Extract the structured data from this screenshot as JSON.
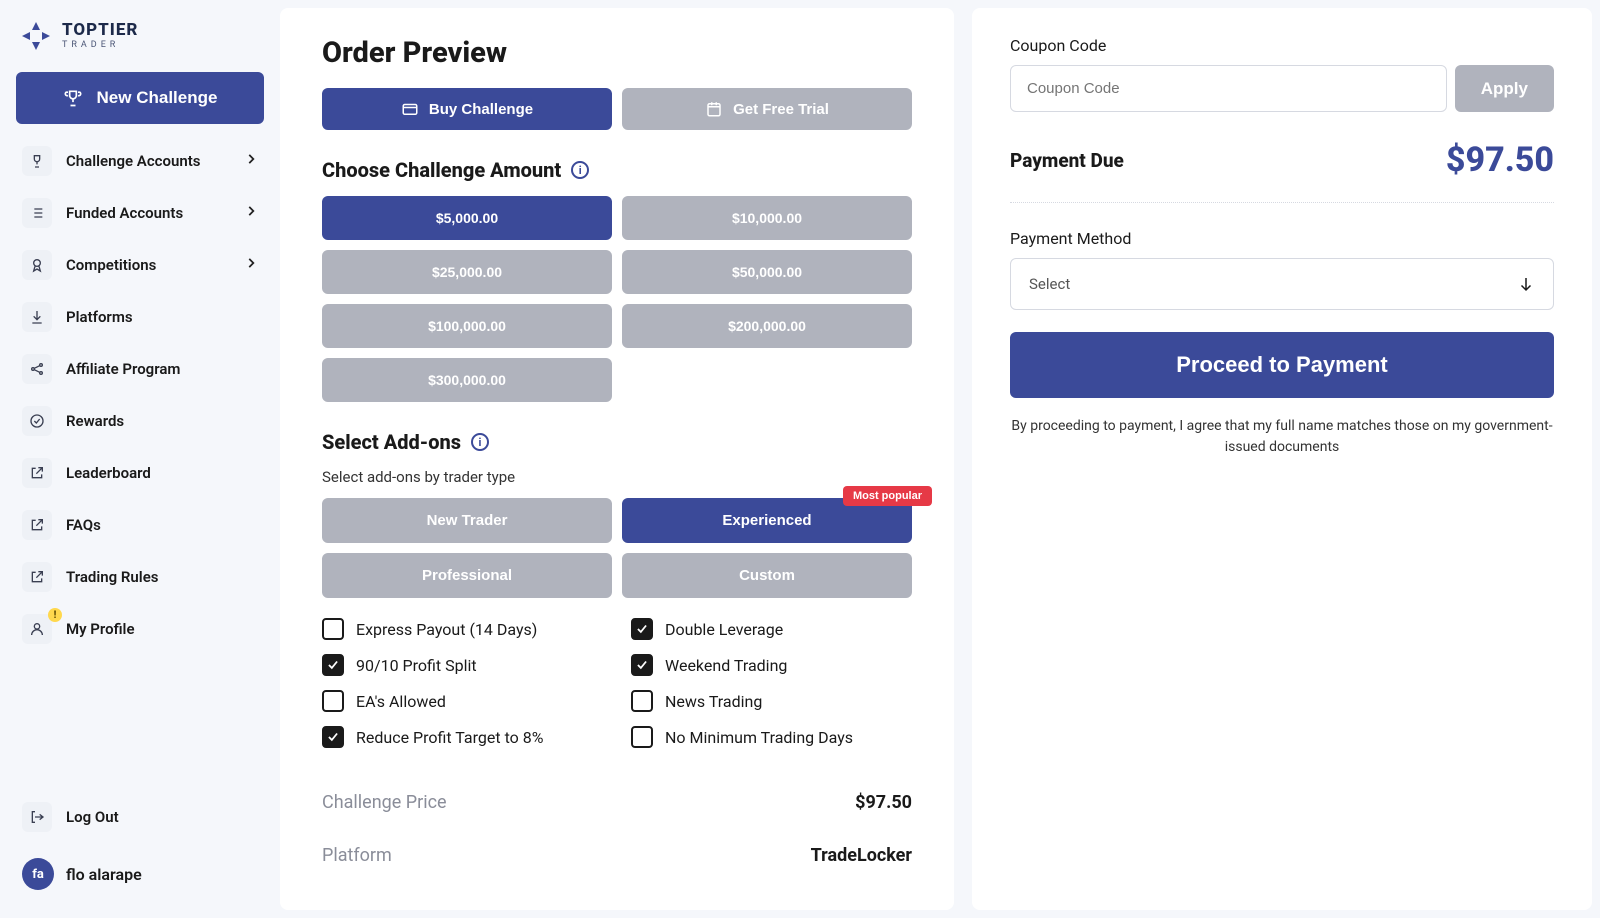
{
  "brand": {
    "name": "TOPTIER",
    "sub": "TRADER"
  },
  "sidebar": {
    "cta": "New Challenge",
    "items": [
      {
        "label": "Challenge Accounts",
        "icon": "trophy",
        "chevron": true
      },
      {
        "label": "Funded Accounts",
        "icon": "list",
        "chevron": true
      },
      {
        "label": "Competitions",
        "icon": "medal",
        "chevron": true
      },
      {
        "label": "Platforms",
        "icon": "download",
        "chevron": false
      },
      {
        "label": "Affiliate Program",
        "icon": "share",
        "chevron": false
      },
      {
        "label": "Rewards",
        "icon": "check-circle",
        "chevron": false
      },
      {
        "label": "Leaderboard",
        "icon": "external",
        "chevron": false
      },
      {
        "label": "FAQs",
        "icon": "external",
        "chevron": false
      },
      {
        "label": "Trading Rules",
        "icon": "external",
        "chevron": false
      },
      {
        "label": "My Profile",
        "icon": "user",
        "chevron": false,
        "alert": true
      }
    ],
    "logout": "Log Out",
    "user": {
      "initials": "fa",
      "name": "flo alarape"
    }
  },
  "order": {
    "title": "Order Preview",
    "buy": "Buy Challenge",
    "trial": "Get Free Trial",
    "amountTitle": "Choose Challenge Amount",
    "amounts": [
      "$5,000.00",
      "$10,000.00",
      "$25,000.00",
      "$50,000.00",
      "$100,000.00",
      "$200,000.00",
      "$300,000.00"
    ],
    "selectedAmount": 0,
    "addonsTitle": "Select Add-ons",
    "addonsSub": "Select add-ons by trader type",
    "traderTypes": [
      "New Trader",
      "Experienced",
      "Professional",
      "Custom"
    ],
    "selectedTrader": 1,
    "popularTag": "Most popular",
    "addons": [
      {
        "label": "Express Payout (14 Days)",
        "checked": false
      },
      {
        "label": "Double Leverage",
        "checked": true
      },
      {
        "label": "90/10 Profit Split",
        "checked": true
      },
      {
        "label": "Weekend Trading",
        "checked": true
      },
      {
        "label": "EA's Allowed",
        "checked": false
      },
      {
        "label": "News Trading",
        "checked": false
      },
      {
        "label": "Reduce Profit Target to 8%",
        "checked": true
      },
      {
        "label": "No Minimum Trading Days",
        "checked": false
      }
    ],
    "summary": {
      "priceLabel": "Challenge Price",
      "priceValue": "$97.50",
      "platformLabel": "Platform",
      "platformValue": "TradeLocker"
    }
  },
  "payment": {
    "couponLabel": "Coupon Code",
    "couponPlaceholder": "Coupon Code",
    "apply": "Apply",
    "dueLabel": "Payment Due",
    "dueAmount": "$97.50",
    "methodLabel": "Payment Method",
    "methodPlaceholder": "Select",
    "proceed": "Proceed to Payment",
    "disclaimer": "By proceeding to payment, I agree that my full name matches those on my government-issued documents"
  }
}
